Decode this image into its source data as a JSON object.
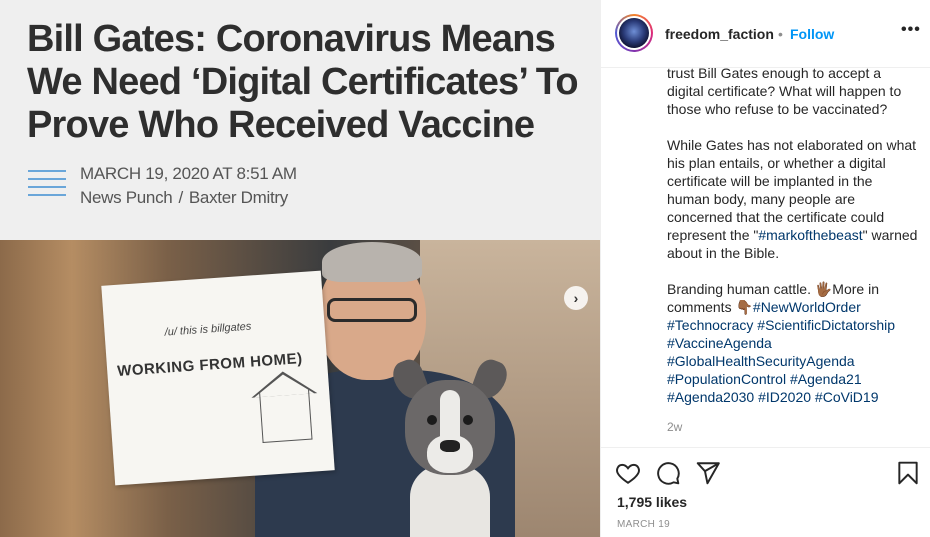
{
  "article": {
    "headline_line1": "Bill Gates: Coronavirus Means",
    "headline_line2": "We Need ‘Digital Certificates’ To",
    "headline_line3": "Prove Who Received Vaccine",
    "date": "MARCH 19, 2020 AT 8:51 AM",
    "source": "News Punch",
    "separator": "/",
    "author": "Baxter Dmitry"
  },
  "photo_sign": {
    "small_text": "/u/ this is billgates",
    "main_text": "WORKING FROM HOME)"
  },
  "carousel": {
    "next_glyph": "›"
  },
  "post": {
    "username": "freedom_faction",
    "dot": "•",
    "follow_label": "Follow",
    "more_glyph": "•••",
    "caption_p1": "trust Bill Gates enough to accept a digital certificate? What will happen to those who refuse to be vaccinated?",
    "caption_p2_a": "While Gates has not elaborated on what his plan entails, or whether a digital certificate will be implanted in the human body, many people are concerned that the certificate could represent the \"",
    "caption_p2_tag": "#markofthebeast",
    "caption_p2_b": "\" warned about in the Bible.",
    "caption_p3_a": "Branding human cattle. 🖐🏾More in comments 👇🏾",
    "hashtags": [
      "#NewWorldOrder",
      "#Technocracy",
      "#ScientificDictatorship",
      "#VaccineAgenda",
      "#GlobalHealthSecurityAgenda",
      "#PopulationControl",
      "#Agenda21",
      "#Agenda2030",
      "#ID2020",
      "#CoViD19"
    ],
    "relative_time": "2w",
    "likes": "1,795 likes",
    "date": "MARCH 19"
  },
  "colors": {
    "link": "#00376b",
    "follow": "#0095f6",
    "muted": "#8e8e8e"
  },
  "icons": [
    "heart-icon",
    "comment-icon",
    "share-icon",
    "bookmark-icon",
    "more-options-icon",
    "chevron-right-icon"
  ]
}
